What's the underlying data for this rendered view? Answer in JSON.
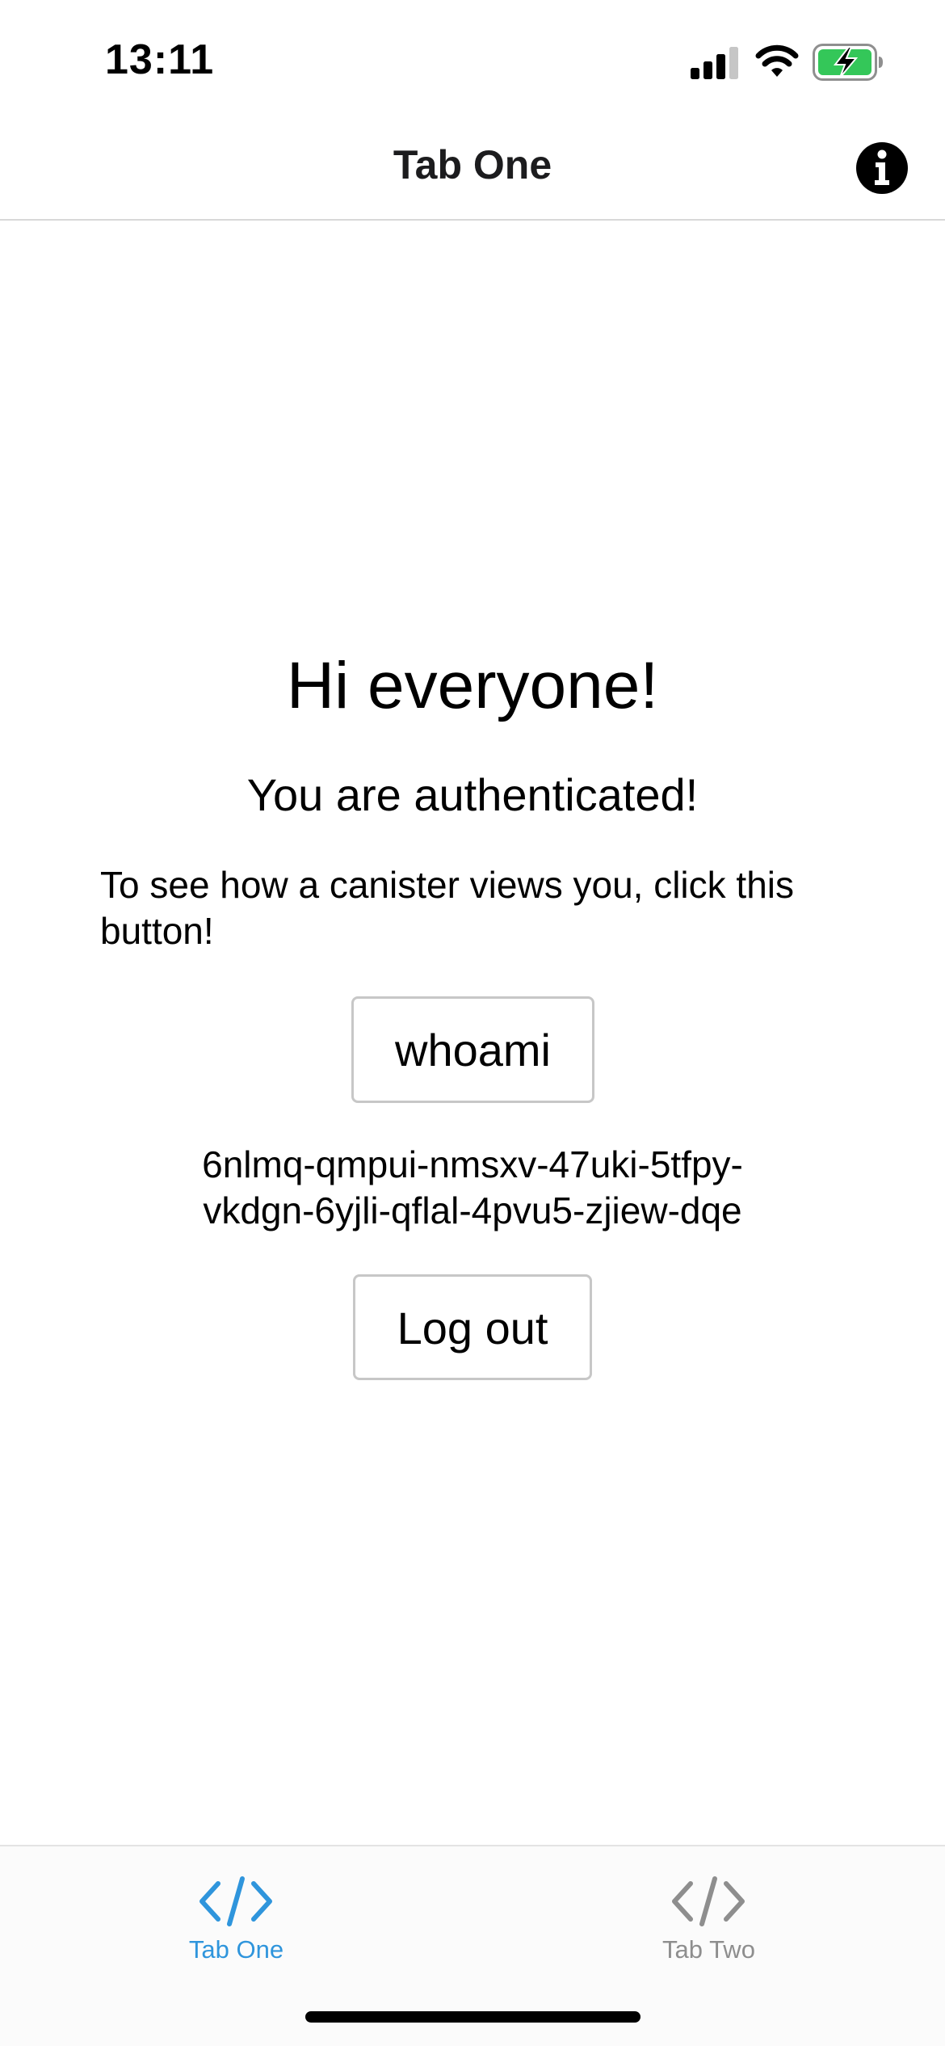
{
  "status_bar": {
    "time": "13:11",
    "signal_icon": "cellular-signal-icon",
    "wifi_icon": "wifi-icon",
    "battery_icon": "battery-charging-icon",
    "battery_color": "#34c759"
  },
  "header": {
    "title": "Tab One",
    "info_icon": "info-circle-icon"
  },
  "main": {
    "greeting": "Hi everyone!",
    "auth_status": "You are authenticated!",
    "instruction": "To see how a canister views you, click this button!",
    "whoami_label": "whoami",
    "principal_line1": "6nlmq-qmpui-nmsxv-47uki-5tfpy-",
    "principal_line2": "vkdgn-6yjli-qflal-4pvu5-zjiew-dqe",
    "logout_label": "Log out"
  },
  "tab_bar": {
    "active_color": "#2f95dc",
    "inactive_color": "#8e8e8e",
    "tabs": [
      {
        "label": "Tab One",
        "icon": "code-icon",
        "active": true
      },
      {
        "label": "Tab Two",
        "icon": "code-icon",
        "active": false
      }
    ]
  }
}
